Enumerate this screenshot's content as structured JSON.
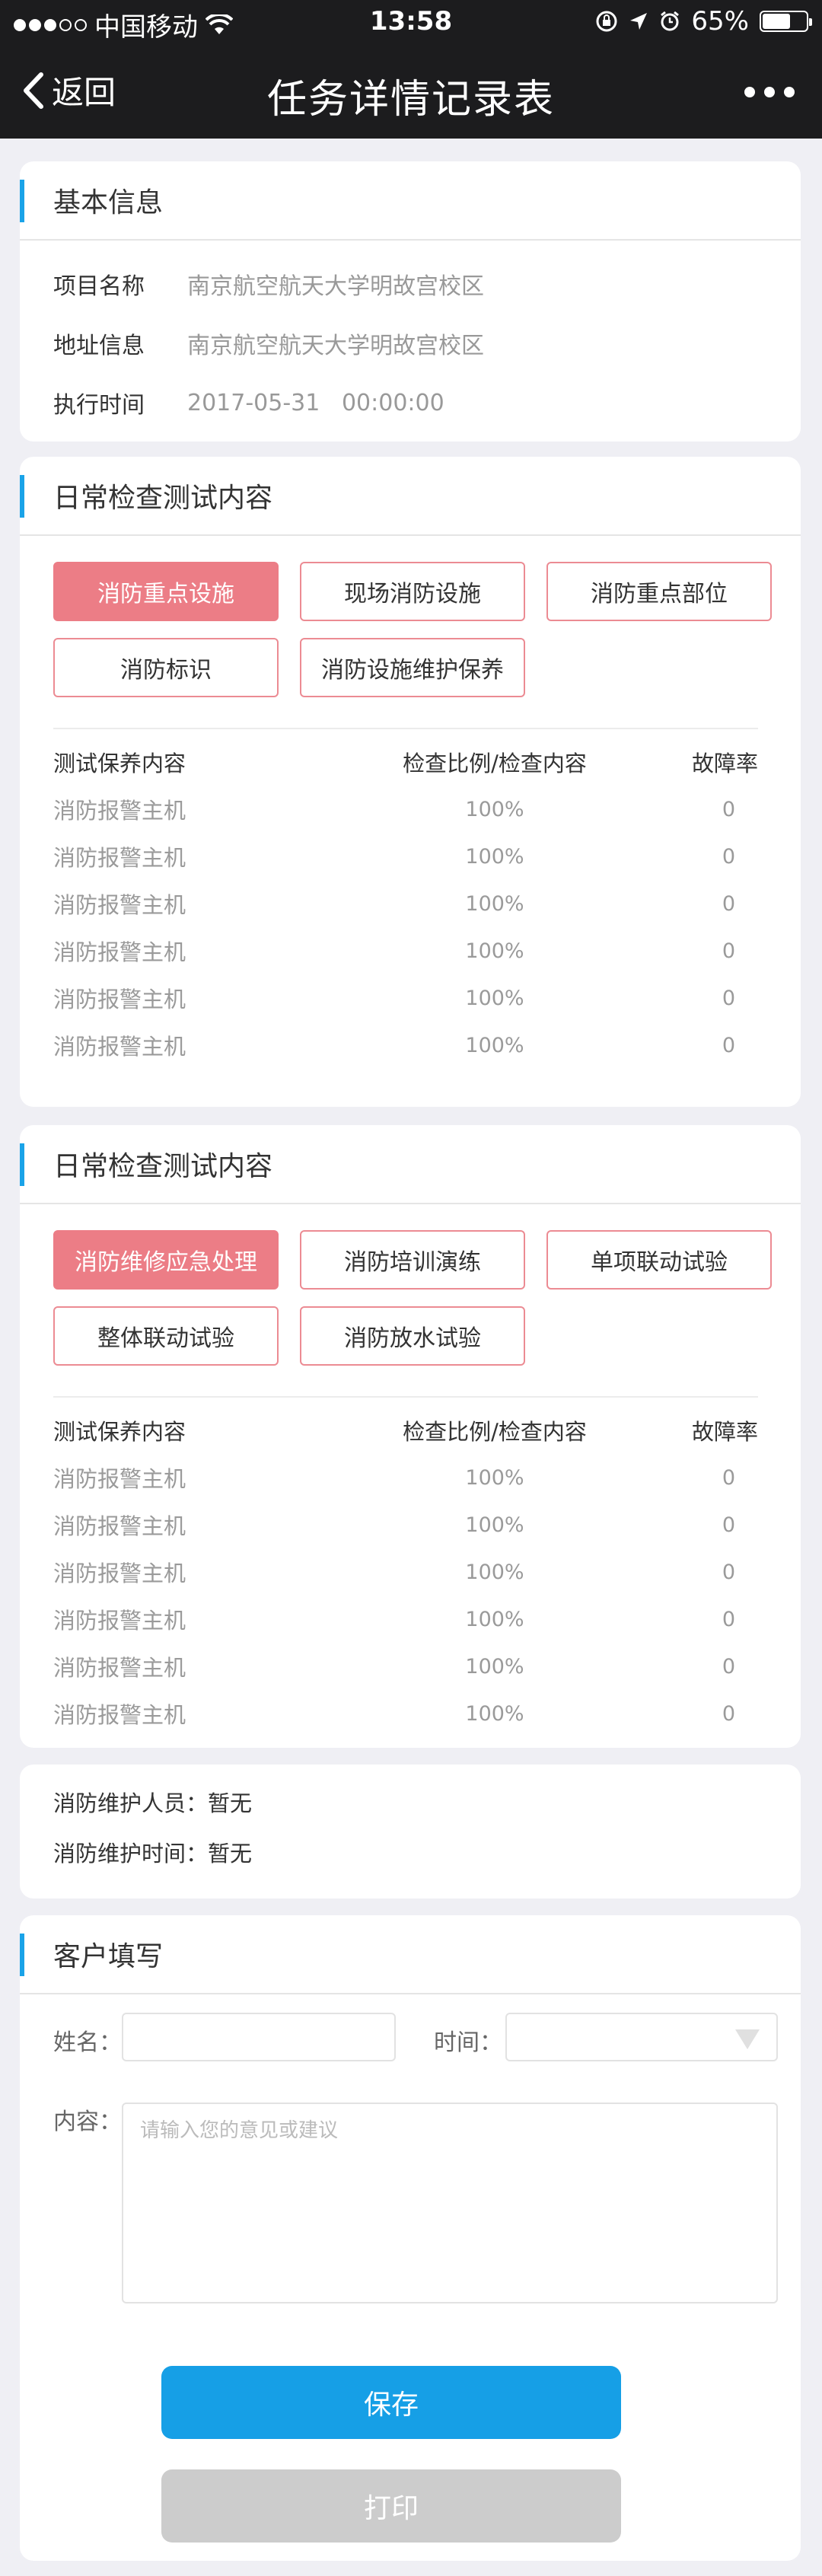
{
  "status_bar": {
    "carrier": "中国移动",
    "time": "13:58",
    "battery": "65%"
  },
  "nav": {
    "back_label": "返回",
    "title": "任务详情记录表"
  },
  "basic_info": {
    "title": "基本信息",
    "rows": [
      {
        "label": "项目名称",
        "value": "南京航空航天大学明故宫校区"
      },
      {
        "label": "地址信息",
        "value": "南京航空航天大学明故宫校区"
      },
      {
        "label": "执行时间",
        "value": "2017-05-31   00:00:00"
      }
    ]
  },
  "inspection1": {
    "title": "日常检查测试内容",
    "tags": [
      "消防重点设施",
      "现场消防设施",
      "消防重点部位",
      "消防标识",
      "消防设施维护保养"
    ],
    "headers": [
      "测试保养内容",
      "检查比例/检查内容",
      "故障率"
    ],
    "rows": [
      [
        "消防报警主机",
        "100%",
        "0"
      ],
      [
        "消防报警主机",
        "100%",
        "0"
      ],
      [
        "消防报警主机",
        "100%",
        "0"
      ],
      [
        "消防报警主机",
        "100%",
        "0"
      ],
      [
        "消防报警主机",
        "100%",
        "0"
      ],
      [
        "消防报警主机",
        "100%",
        "0"
      ]
    ]
  },
  "inspection2": {
    "title": "日常检查测试内容",
    "tags": [
      "消防维修应急处理",
      "消防培训演练",
      "单项联动试验",
      "整体联动试验",
      "消防放水试验"
    ],
    "headers": [
      "测试保养内容",
      "检查比例/检查内容",
      "故障率"
    ],
    "rows": [
      [
        "消防报警主机",
        "100%",
        "0"
      ],
      [
        "消防报警主机",
        "100%",
        "0"
      ],
      [
        "消防报警主机",
        "100%",
        "0"
      ],
      [
        "消防报警主机",
        "100%",
        "0"
      ],
      [
        "消防报警主机",
        "100%",
        "0"
      ],
      [
        "消防报警主机",
        "100%",
        "0"
      ]
    ]
  },
  "maintenance": {
    "staff": "消防维护人员：暂无",
    "time": "消防维护时间：暂无"
  },
  "customer": {
    "title": "客户填写",
    "name_label": "姓名：",
    "time_label": "时间：",
    "content_label": "内容：",
    "content_placeholder": "请输入您的意见或建议"
  },
  "buttons": {
    "save": "保存",
    "print": "打印"
  }
}
